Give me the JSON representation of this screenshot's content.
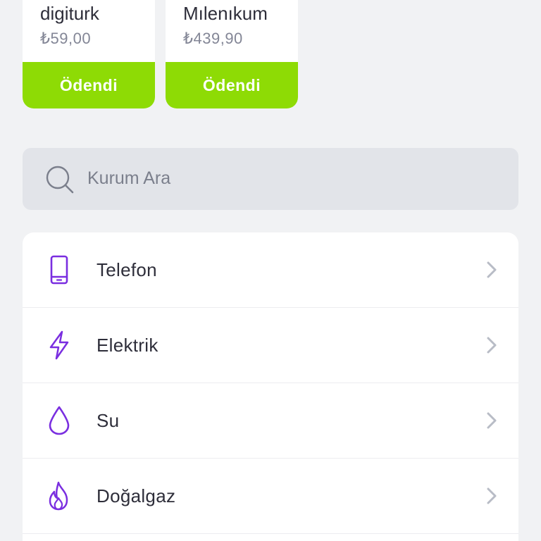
{
  "bills": [
    {
      "name": "digiturk",
      "amount": "₺59,00",
      "status": "Ödendi"
    },
    {
      "name": "Mılenıkum",
      "amount": "₺439,90",
      "status": "Ödendi"
    }
  ],
  "search": {
    "placeholder": "Kurum Ara",
    "icon": "search-icon"
  },
  "categories": [
    {
      "label": "Telefon",
      "icon": "phone-icon"
    },
    {
      "label": "Elektrik",
      "icon": "lightning-icon"
    },
    {
      "label": "Su",
      "icon": "water-drop-icon"
    },
    {
      "label": "Doğalgaz",
      "icon": "flame-icon"
    }
  ],
  "colors": {
    "accent": "#7a2ee0",
    "paid": "#8edb05",
    "background": "#f1f2f4",
    "search_bg": "#e2e4e9"
  }
}
